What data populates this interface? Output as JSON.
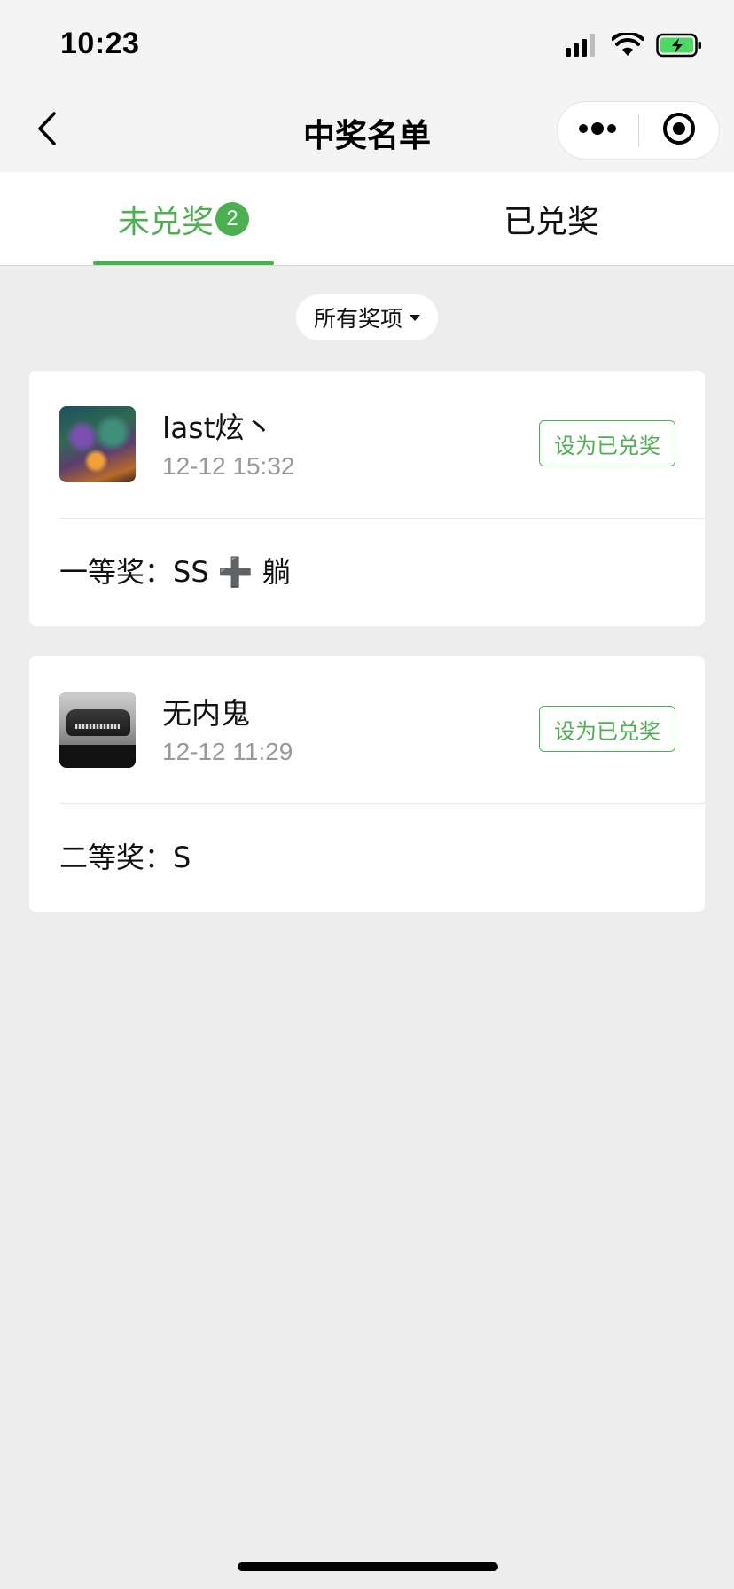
{
  "status_bar": {
    "time": "10:23"
  },
  "nav": {
    "title": "中奖名单"
  },
  "tabs": [
    {
      "label": "未兑奖",
      "badge": "2",
      "active": true
    },
    {
      "label": "已兑奖",
      "active": false
    }
  ],
  "filter": {
    "label": "所有奖项"
  },
  "winners": [
    {
      "name": "last炫丶",
      "time": "12-12 15:32",
      "action": "设为已兑奖",
      "prize": "一等奖：SS ➕ 躺"
    },
    {
      "name": "无内鬼",
      "time": "12-12 11:29",
      "action": "设为已兑奖",
      "prize": "二等奖：S"
    }
  ],
  "colors": {
    "accent": "#4caf50",
    "background": "#ededed",
    "secondary_text": "#999999"
  }
}
